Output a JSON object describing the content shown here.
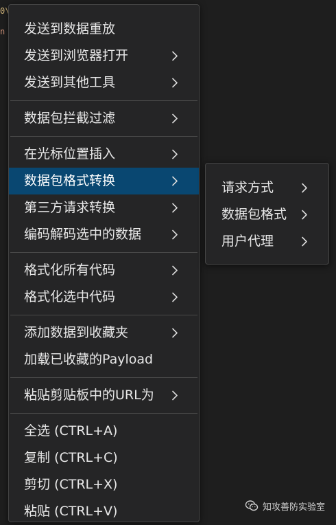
{
  "background_fragments": [
    "0\\",
    "n"
  ],
  "menu": {
    "groups": [
      {
        "items": [
          {
            "label": "发送到数据重放",
            "submenu": false
          },
          {
            "label": "发送到浏览器打开",
            "submenu": true
          },
          {
            "label": "发送到其他工具",
            "submenu": true
          }
        ]
      },
      {
        "items": [
          {
            "label": "数据包拦截过滤",
            "submenu": true
          }
        ]
      },
      {
        "items": [
          {
            "label": "在光标位置插入",
            "submenu": true
          },
          {
            "label": "数据包格式转换",
            "submenu": true,
            "active": true
          },
          {
            "label": "第三方请求转换",
            "submenu": true
          },
          {
            "label": "编码解码选中的数据",
            "submenu": true
          }
        ]
      },
      {
        "items": [
          {
            "label": "格式化所有代码",
            "submenu": true
          },
          {
            "label": "格式化选中代码",
            "submenu": true
          }
        ]
      },
      {
        "items": [
          {
            "label": "添加数据到收藏夹",
            "submenu": true
          },
          {
            "label": "加载已收藏的Payload",
            "submenu": false
          }
        ]
      },
      {
        "items": [
          {
            "label": "粘贴剪贴板中的URL为",
            "submenu": true
          }
        ]
      },
      {
        "items": [
          {
            "label": "全选 (CTRL+A)",
            "submenu": false
          },
          {
            "label": "复制 (CTRL+C)",
            "submenu": false
          },
          {
            "label": "剪切 (CTRL+X)",
            "submenu": false
          },
          {
            "label": "粘贴 (CTRL+V)",
            "submenu": false
          }
        ]
      }
    ]
  },
  "submenu": {
    "items": [
      {
        "label": "请求方式",
        "submenu": true
      },
      {
        "label": "数据包格式",
        "submenu": true
      },
      {
        "label": "用户代理",
        "submenu": true
      }
    ]
  },
  "watermark": {
    "text": "知攻善防实验室",
    "icon": "wechat-icon"
  },
  "colors": {
    "menu_bg": "#252526",
    "active_bg": "#094771",
    "separator": "#4a4a4a",
    "text": "#e8e8e8"
  }
}
